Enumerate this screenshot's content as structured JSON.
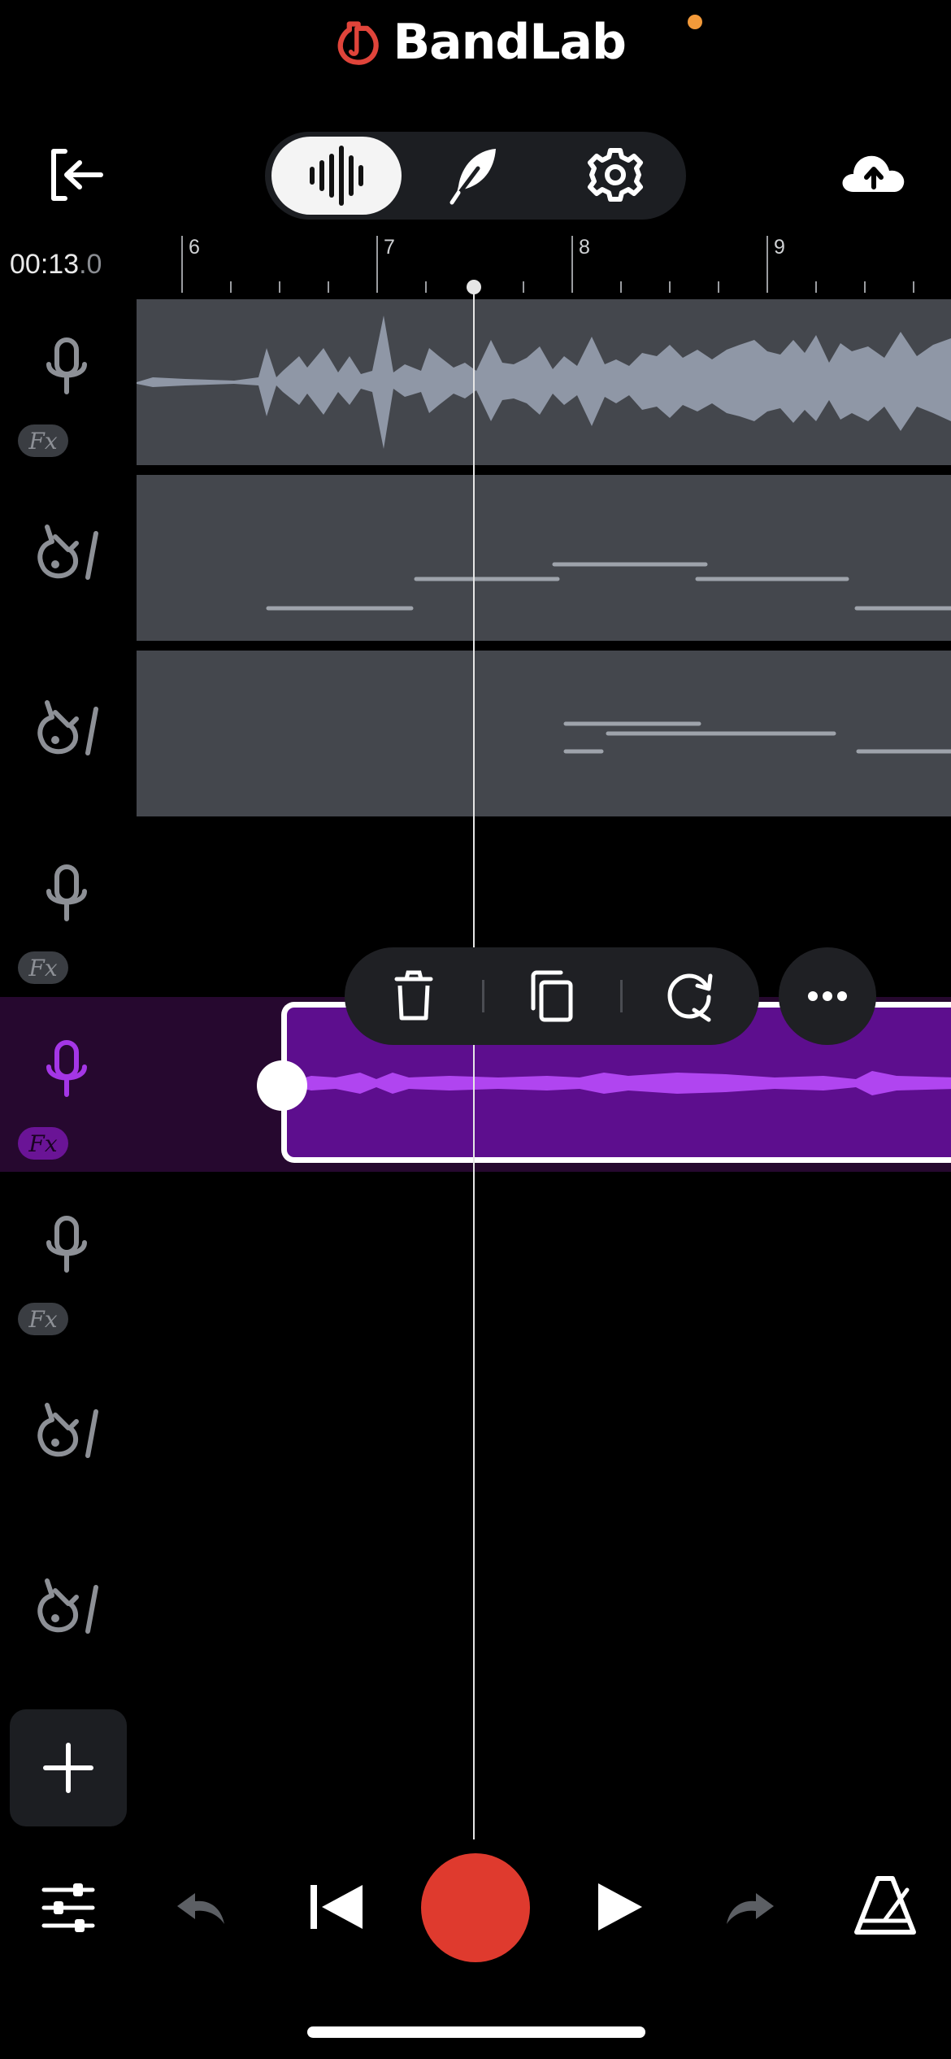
{
  "header": {
    "app_name": "BandLab"
  },
  "toolbar": {
    "exit_icon": "exit-studio-icon",
    "modes": [
      {
        "name": "tracks-waveform",
        "icon": "waveform-icon",
        "selected": true
      },
      {
        "name": "lyrics",
        "icon": "quill-icon",
        "selected": false
      },
      {
        "name": "settings",
        "icon": "gear-icon",
        "selected": false
      }
    ],
    "upload_icon": "cloud-upload-icon"
  },
  "timeline": {
    "time_main": "00:13",
    "time_fraction": ".0",
    "bars": [
      "6",
      "7",
      "8",
      "9"
    ]
  },
  "tracks": [
    {
      "type": "vocal",
      "icon": "microphone-icon",
      "fx": "Fx",
      "has_clip": true,
      "clip": "audio-waveform"
    },
    {
      "type": "instrument",
      "icon": "guitar-icon",
      "has_clip": true,
      "clip": "midi"
    },
    {
      "type": "instrument",
      "icon": "guitar-icon",
      "has_clip": true,
      "clip": "midi"
    },
    {
      "type": "vocal",
      "icon": "microphone-icon",
      "fx": "Fx",
      "has_clip": false
    },
    {
      "type": "vocal",
      "icon": "microphone-icon",
      "fx": "Fx",
      "has_clip": true,
      "clip": "selected-audio",
      "selected": true
    },
    {
      "type": "vocal",
      "icon": "microphone-icon",
      "fx": "Fx",
      "has_clip": false
    },
    {
      "type": "instrument",
      "icon": "guitar-icon",
      "has_clip": false
    },
    {
      "type": "instrument",
      "icon": "guitar-icon",
      "has_clip": false
    }
  ],
  "clip_menu": {
    "actions": [
      "delete-icon",
      "duplicate-icon",
      "loop-icon"
    ],
    "more": "more-icon"
  },
  "add_track": {
    "icon": "plus-icon"
  },
  "transport": {
    "buttons": [
      "mixer-icon",
      "undo-icon",
      "skip-back-icon",
      "record-button",
      "play-icon",
      "redo-icon",
      "metronome-icon"
    ]
  },
  "colors": {
    "brand_red": "#e0443a",
    "record_red": "#df3a2e",
    "selected_purple": "#5d0e8e",
    "selected_row": "#26082f",
    "waveform_purple": "#b045f0",
    "clip_gray": "#44474d",
    "notification": "#f39a3a"
  }
}
